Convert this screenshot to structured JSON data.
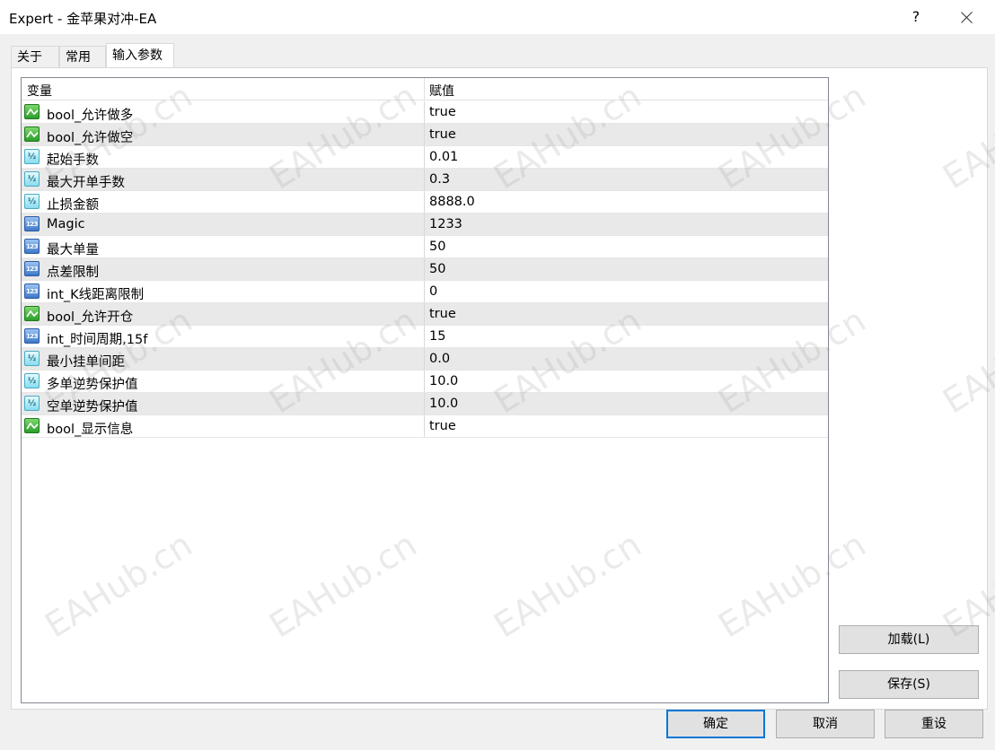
{
  "window": {
    "title": "Expert - 金苹果对冲-EA",
    "help_label": "?"
  },
  "tabs": [
    {
      "label": "关于",
      "active": false
    },
    {
      "label": "常用",
      "active": false
    },
    {
      "label": "输入参数",
      "active": true
    }
  ],
  "grid": {
    "headers": {
      "variable": "变量",
      "value": "赋值"
    },
    "rows": [
      {
        "type": "bool",
        "name": "bool_允许做多",
        "value": "true"
      },
      {
        "type": "bool",
        "name": "bool_允许做空",
        "value": "true"
      },
      {
        "type": "double",
        "name": "起始手数",
        "value": "0.01"
      },
      {
        "type": "double",
        "name": "最大开单手数",
        "value": "0.3"
      },
      {
        "type": "double",
        "name": "止损金额",
        "value": "8888.0"
      },
      {
        "type": "int",
        "name": "Magic",
        "value": "1233"
      },
      {
        "type": "int",
        "name": "最大单量",
        "value": "50"
      },
      {
        "type": "int",
        "name": "点差限制",
        "value": "50"
      },
      {
        "type": "int",
        "name": "int_K线距离限制",
        "value": "0"
      },
      {
        "type": "bool",
        "name": "bool_允许开仓",
        "value": "true"
      },
      {
        "type": "int",
        "name": "int_时间周期,15f",
        "value": "15"
      },
      {
        "type": "double",
        "name": "最小挂单间距",
        "value": "0.0"
      },
      {
        "type": "double",
        "name": "多单逆势保护值",
        "value": "10.0"
      },
      {
        "type": "double",
        "name": "空单逆势保护值",
        "value": "10.0"
      },
      {
        "type": "bool",
        "name": "bool_显示信息",
        "value": "true"
      }
    ]
  },
  "icons": {
    "double": "½",
    "int": "123"
  },
  "buttons": {
    "load": "加载(L)",
    "save": "保存(S)",
    "ok": "确定",
    "cancel": "取消",
    "reset": "重设"
  },
  "watermark": "EAHub.cn",
  "colors": {
    "accent": "#0078d7",
    "alt_row": "#e9e9e9"
  }
}
